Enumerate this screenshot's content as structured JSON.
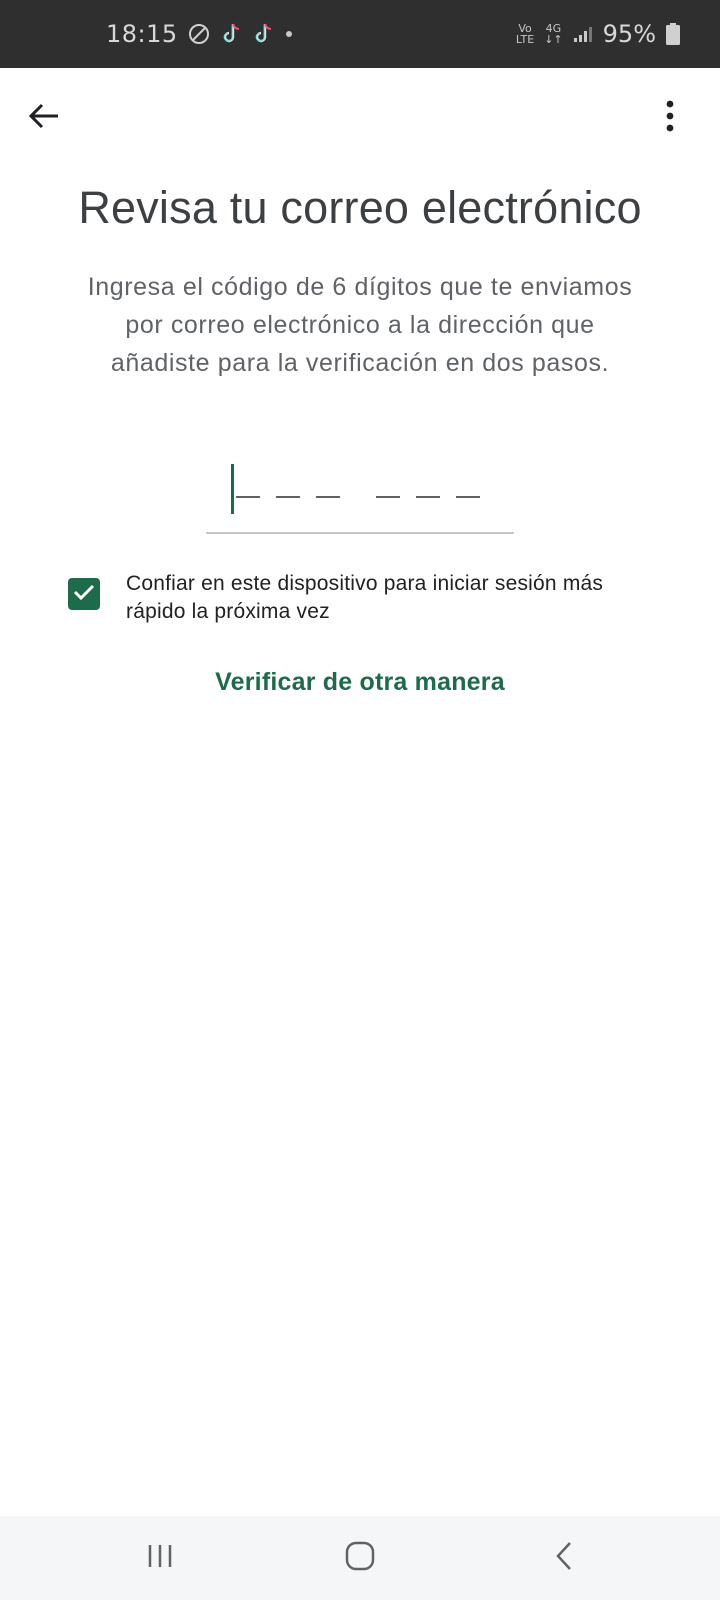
{
  "status_bar": {
    "time": "18:15",
    "icons_left": [
      "do-not-disturb-icon",
      "tiktok-icon",
      "tiktok-icon",
      "dot-icon"
    ],
    "volte_top": "Vo",
    "volte_bottom": "LTE",
    "network_top": "4G",
    "network_bottom": "↓↑",
    "battery": "95%"
  },
  "app_bar": {
    "back_icon": "arrow-back-icon",
    "more_icon": "more-vert-icon"
  },
  "page": {
    "title": "Revisa tu correo electrónico",
    "description": "Ingresa el código de 6 dígitos que te enviamos por correo electrónico a la dirección que añadiste para la verificación en dos pasos.",
    "code_value": "",
    "trust_label": "Confiar en este dispositivo para iniciar sesión más rápido la próxima vez",
    "trust_checked": true,
    "alt_link": "Verificar de otra manera"
  },
  "nav_bar": {
    "recents_icon": "recents-icon",
    "home_icon": "home-icon",
    "back_icon": "back-chevron-icon"
  },
  "colors": {
    "accent": "#1e6b4a",
    "status_bar": "#2f2f2f",
    "nav_bar": "#f5f6f8",
    "title": "#3c4043",
    "description": "#5f6368"
  }
}
